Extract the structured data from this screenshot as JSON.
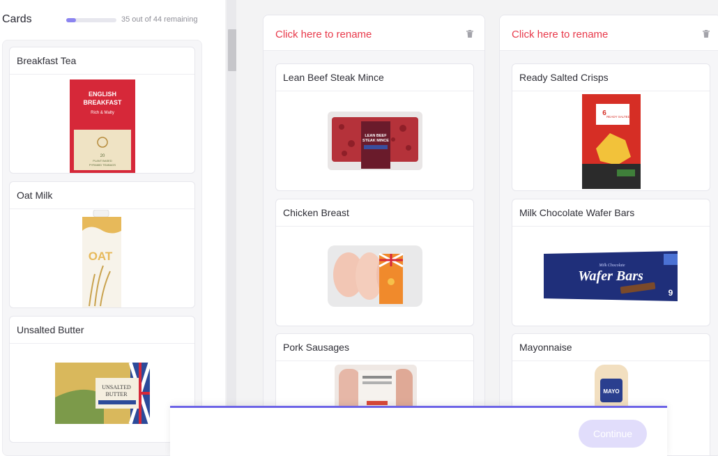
{
  "sidebar": {
    "title": "Cards",
    "progress_fraction": 0.2,
    "progress_text": "35 out of 44 remaining",
    "cards": [
      {
        "label": "Breakfast Tea",
        "image_icon": "tea-box-icon",
        "image_text": [
          "ENGLISH",
          "BREAKFAST",
          "Rich & Malty",
          "20",
          "PLANT BASED",
          "PYRAMID TEABAGS"
        ]
      },
      {
        "label": "Oat Milk",
        "image_icon": "oat-milk-carton-icon",
        "image_text": [
          "OAT"
        ]
      },
      {
        "label": "Unsalted Butter",
        "image_icon": "butter-pack-icon",
        "image_text": [
          "UNSALTED",
          "BUTTER"
        ]
      }
    ]
  },
  "groups": [
    {
      "title": "Click here to rename",
      "delete_icon": "trash-icon",
      "cards": [
        {
          "label": "Lean Beef Steak Mince",
          "image_icon": "beef-mince-pack-icon",
          "image_text": [
            "LEAN BEEF",
            "STEAK MINCE"
          ]
        },
        {
          "label": "Chicken Breast",
          "image_icon": "chicken-breast-pack-icon"
        },
        {
          "label": "Pork Sausages",
          "image_icon": "sausage-pack-icon"
        }
      ]
    },
    {
      "title": "Click here to rename",
      "delete_icon": "trash-icon",
      "cards": [
        {
          "label": "Ready Salted Crisps",
          "image_icon": "crisps-bag-icon",
          "image_text": [
            "6",
            "READY SALTED"
          ]
        },
        {
          "label": "Milk Chocolate Wafer Bars",
          "image_icon": "wafer-bars-pack-icon",
          "image_text": [
            "Wafer Bars",
            "9",
            "Milk Chocolate"
          ]
        },
        {
          "label": "Mayonnaise",
          "image_icon": "mayo-bottle-icon",
          "image_text": [
            "MAYO"
          ]
        }
      ]
    }
  ],
  "footer": {
    "continue_label": "Continue"
  },
  "colors": {
    "accent": "#6c63e6",
    "rename": "#e8394a",
    "continue_disabled": "#e1ddfb"
  }
}
